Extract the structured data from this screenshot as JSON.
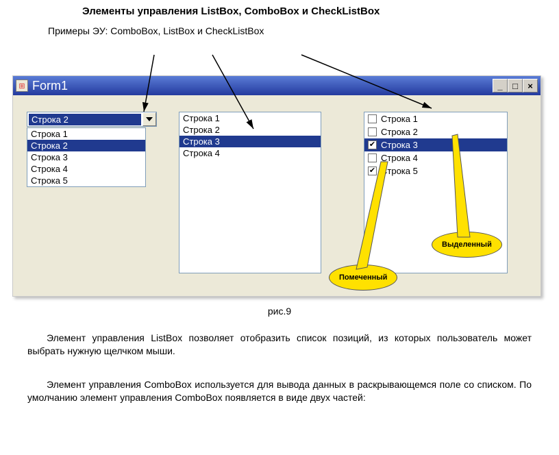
{
  "title": "Элементы управления ListBox, ComboBox и CheckListBox",
  "subtitle": "Примеры ЭУ: ComboBox, ListBox и CheckListBox",
  "window": {
    "caption": "Form1",
    "min": "_",
    "max": "□",
    "close": "×"
  },
  "combo": {
    "selected": "Строка 2",
    "items": [
      "Строка 1",
      "Строка 2",
      "Строка 3",
      "Строка 4",
      "Строка 5"
    ],
    "selectedIndex": 1
  },
  "listbox": {
    "items": [
      "Строка 1",
      "Строка 2",
      "Строка 3",
      "Строка 4"
    ],
    "selectedIndex": 2
  },
  "checklist": {
    "items": [
      {
        "label": "Строка 1",
        "checked": false
      },
      {
        "label": "Строка 2",
        "checked": false
      },
      {
        "label": "Строка 3",
        "checked": true
      },
      {
        "label": "Строка 4",
        "checked": false
      },
      {
        "label": "Строка 5",
        "checked": true
      }
    ],
    "selectedIndex": 2
  },
  "callouts": {
    "marked": "Помеченный",
    "selected": "Выделенный"
  },
  "figcaption": "рис.9",
  "paragraph1": "Элемент управления ListBox позволяет отобразить список позиций, из которых пользователь может выбрать нужную щелчком мыши.",
  "paragraph2": "Элемент управления ComboBox используется для вывода данных в раскрывающемся поле со списком. По умолчанию элемент управления ComboBox появляется в виде двух частей:"
}
